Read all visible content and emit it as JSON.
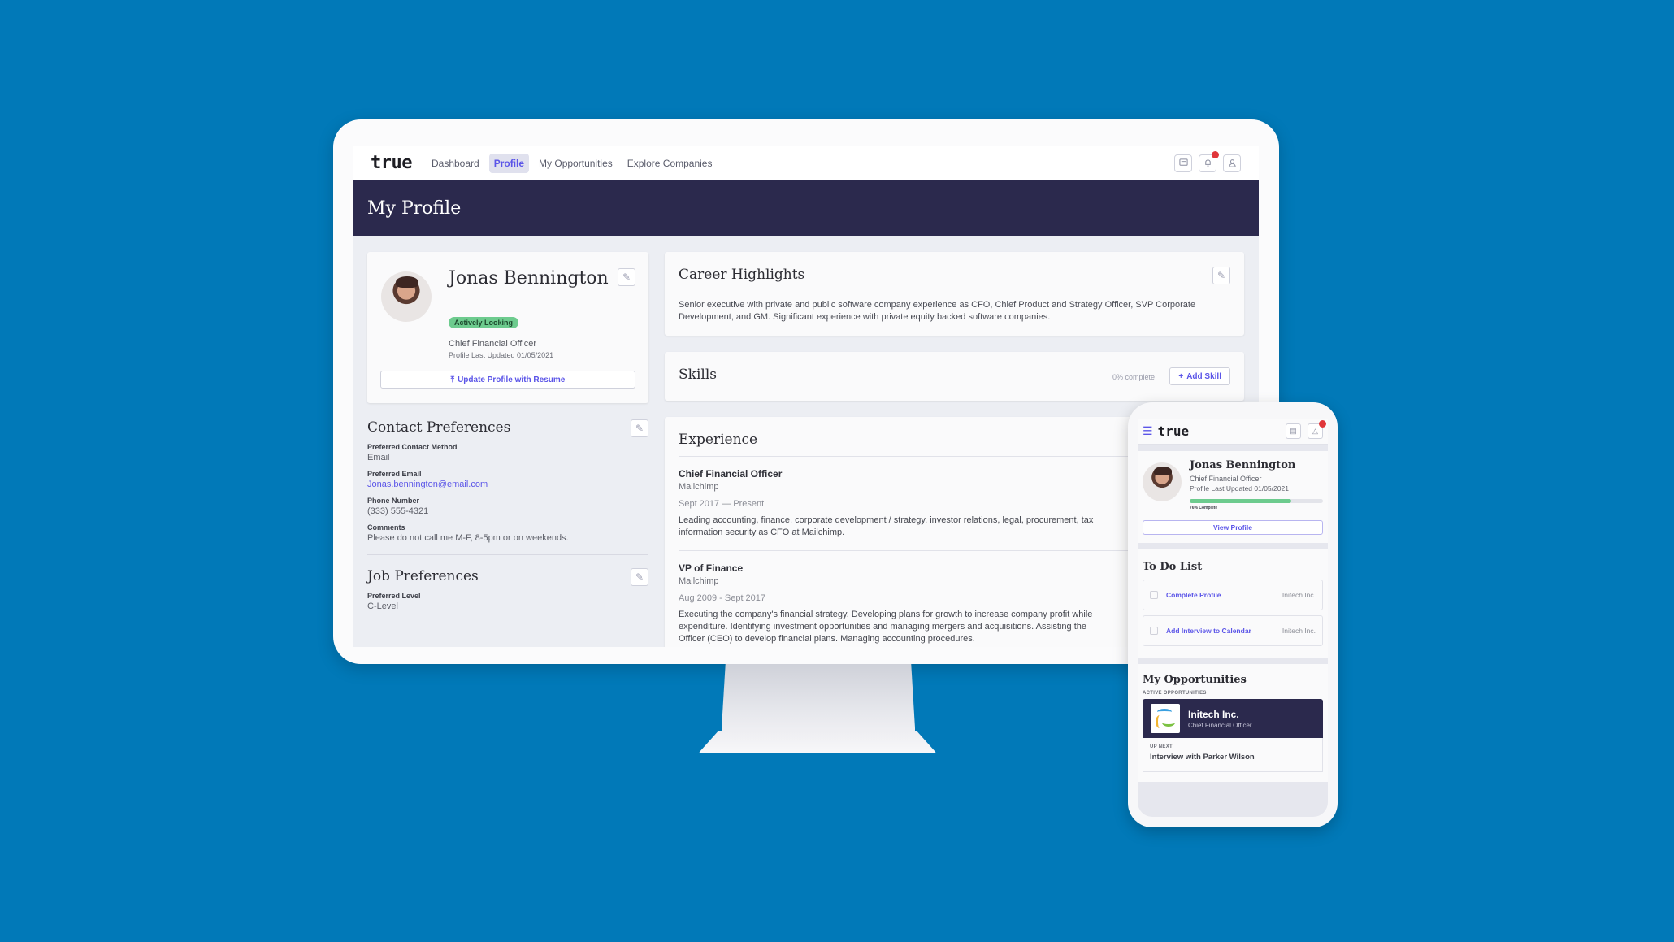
{
  "theme": {
    "background": "#0179b8",
    "accent": "#5b55e8",
    "header_band": "#2b294d",
    "badge_green": "#6dcb8e",
    "notification_red": "#e0363a"
  },
  "desktop": {
    "nav": {
      "logo": "true",
      "links": [
        {
          "label": "Dashboard",
          "active": false
        },
        {
          "label": "Profile",
          "active": true
        },
        {
          "label": "My Opportunities",
          "active": false
        },
        {
          "label": "Explore Companies",
          "active": false
        }
      ],
      "icons": [
        "chat-icon",
        "bell-icon",
        "user-icon"
      ]
    },
    "page_title": "My Profile",
    "profile": {
      "name": "Jonas Bennington",
      "status_badge": "Actively Looking",
      "title": "Chief Financial Officer",
      "last_updated": "Profile Last Updated 01/05/2021",
      "resume_button": "Update Profile with Resume"
    },
    "contact_preferences": {
      "title": "Contact Preferences",
      "fields": [
        {
          "label": "Preferred Contact Method",
          "value": "Email"
        },
        {
          "label": "Preferred Email",
          "value": "Jonas.bennington@email.com"
        },
        {
          "label": "Phone Number",
          "value": "(333) 555-4321"
        },
        {
          "label": "Comments",
          "value": "Please do not call me M-F, 8-5pm or on weekends."
        }
      ]
    },
    "job_preferences": {
      "title": "Job Preferences",
      "fields": [
        {
          "label": "Preferred Level",
          "value": "C-Level"
        }
      ]
    },
    "career_highlights": {
      "title": "Career Highlights",
      "text": "Senior executive with private and public software company experience as CFO, Chief Product and Strategy Officer, SVP Corporate Development, and GM. Significant experience with private equity backed software companies."
    },
    "skills": {
      "title": "Skills",
      "completion": "0% complete",
      "add_button": "Add Skill"
    },
    "experience": {
      "title": "Experience",
      "jobs": [
        {
          "title": "Chief Financial Officer",
          "company": "Mailchimp",
          "dates": "Sept 2017 — Present",
          "description_line1": "Leading accounting, finance, corporate development / strategy, investor relations, legal, procurement, tax",
          "description_line2": "information security as CFO at Mailchimp."
        },
        {
          "title": "VP of Finance",
          "company": "Mailchimp",
          "dates": "Aug 2009 - Sept 2017",
          "description_line1": "Executing the company's financial strategy. Developing plans for growth to increase company profit while",
          "description_line2": "expenditure. Identifying investment opportunities and managing mergers and acquisitions. Assisting the",
          "description_line3": "Officer (CEO) to develop financial plans. Managing accounting procedures."
        }
      ]
    }
  },
  "mobile": {
    "logo": "true",
    "profile": {
      "name": "Jonas Bennington",
      "title": "Chief Financial Officer",
      "last_updated": "Profile Last Updated 01/05/2021",
      "progress_percent": 76,
      "progress_label": "76% Complete",
      "view_button": "View Profile"
    },
    "todo": {
      "title": "To Do List",
      "items": [
        {
          "label": "Complete Profile",
          "company": "Initech Inc."
        },
        {
          "label": "Add Interview to Calendar",
          "company": "Initech Inc."
        }
      ]
    },
    "opportunities": {
      "title": "My Opportunities",
      "subtitle": "ACTIVE OPPORTUNITIES",
      "company": "Initech Inc.",
      "role": "Chief Financial Officer",
      "up_next_label": "UP NEXT",
      "up_next": "Interview with Parker Wilson"
    }
  }
}
